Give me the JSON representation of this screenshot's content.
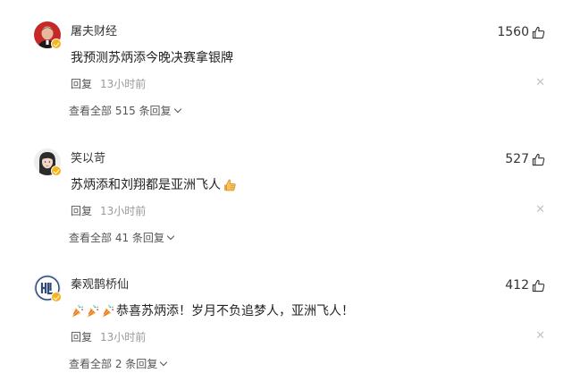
{
  "comments": [
    {
      "username": "屠夫财经",
      "likes": "1560",
      "content": "我预测苏炳添今晚决赛拿银牌",
      "reply_label": "回复",
      "time": "13小时前",
      "view_all": "查看全部 515 条回复",
      "avatar_icon": "avatar-man-red",
      "content_emojis": []
    },
    {
      "username": "笑以苛",
      "likes": "527",
      "content": "苏炳添和刘翔都是亚洲飞人",
      "reply_label": "回复",
      "time": "13小时前",
      "view_all": "查看全部 41 条回复",
      "avatar_icon": "avatar-woman",
      "content_emojis": [
        "thumbs-up-emoji"
      ]
    },
    {
      "username": "秦观鹊桥仙",
      "likes": "412",
      "content": "恭喜苏炳添！岁月不负追梦人，亚洲飞人！",
      "reply_label": "回复",
      "time": "13小时前",
      "view_all": "查看全部 2 条回复",
      "avatar_icon": "avatar-logo-blue",
      "content_emojis": [
        "party-popper-emoji",
        "party-popper-emoji",
        "party-popper-emoji"
      ]
    }
  ],
  "icons": {
    "like": "thumbs-up-outline-icon",
    "close": "close-icon",
    "expand": "chevron-down-icon",
    "verified": "verified-badge-icon"
  },
  "colors": {
    "verified_badge": "#f6b31a",
    "time_text": "#999999",
    "close_icon": "#c4c4c4"
  }
}
